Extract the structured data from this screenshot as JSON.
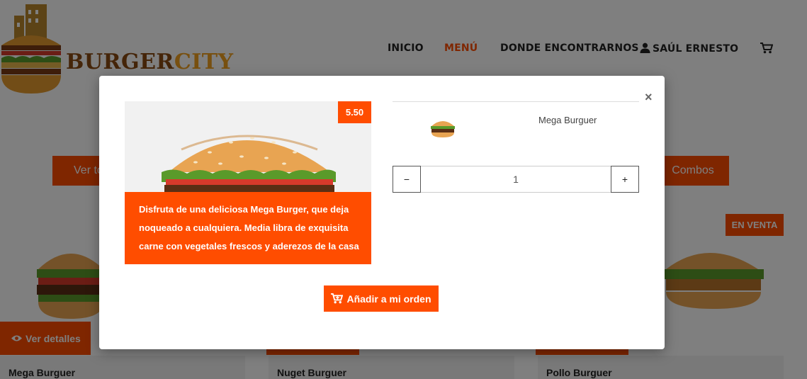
{
  "brand": {
    "name_part1": "BURGER",
    "name_part2": "CITY",
    "accent_color": "#ff4d00"
  },
  "nav": {
    "items": [
      {
        "label": "INICIO",
        "active": false
      },
      {
        "label": "MENÚ",
        "active": true
      },
      {
        "label": "DONDE ENCONTRARNOS",
        "active": false
      }
    ],
    "user_label": "SAÚL ERNESTO",
    "user_icon": "user-icon",
    "cart_icon": "cart-icon"
  },
  "filters": {
    "all_label": "Ver to",
    "combos_label": "Combos"
  },
  "cards": [
    {
      "title": "Mega Burguer",
      "details_label": "Ver detalles"
    },
    {
      "title": "Nuget Burguer"
    },
    {
      "title": "Pollo Burguer",
      "badge": "EN VENTA"
    }
  ],
  "modal": {
    "price": "5.50",
    "description": "Disfruta de una deliciosa Mega Burger, que deja noqueado a cualquiera. Media libra de exquisita carne con vegetales frescos y aderezos de la casa",
    "item_name": "Mega Burguer",
    "close_label": "×",
    "quantity": "1",
    "decrement_label": "−",
    "increment_label": "+",
    "add_button_label": "Añadir a mi orden"
  }
}
